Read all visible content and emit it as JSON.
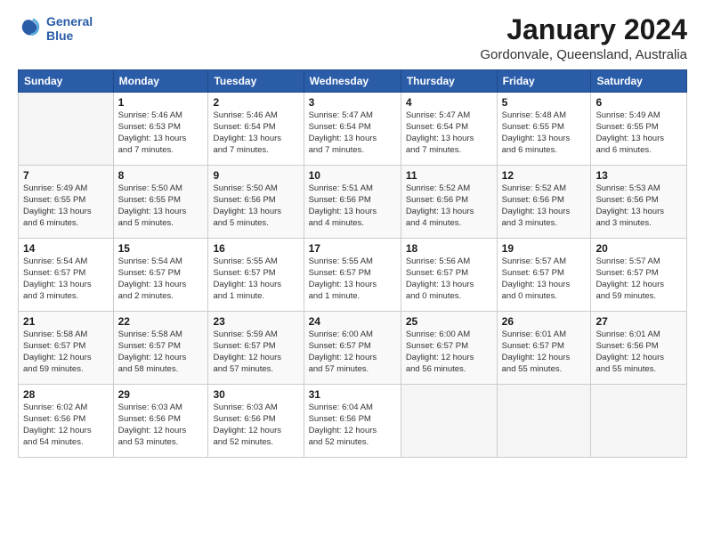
{
  "logo": {
    "line1": "General",
    "line2": "Blue"
  },
  "title": "January 2024",
  "location": "Gordonvale, Queensland, Australia",
  "days_of_week": [
    "Sunday",
    "Monday",
    "Tuesday",
    "Wednesday",
    "Thursday",
    "Friday",
    "Saturday"
  ],
  "weeks": [
    [
      {
        "day": "",
        "info": ""
      },
      {
        "day": "1",
        "info": "Sunrise: 5:46 AM\nSunset: 6:53 PM\nDaylight: 13 hours\nand 7 minutes."
      },
      {
        "day": "2",
        "info": "Sunrise: 5:46 AM\nSunset: 6:54 PM\nDaylight: 13 hours\nand 7 minutes."
      },
      {
        "day": "3",
        "info": "Sunrise: 5:47 AM\nSunset: 6:54 PM\nDaylight: 13 hours\nand 7 minutes."
      },
      {
        "day": "4",
        "info": "Sunrise: 5:47 AM\nSunset: 6:54 PM\nDaylight: 13 hours\nand 7 minutes."
      },
      {
        "day": "5",
        "info": "Sunrise: 5:48 AM\nSunset: 6:55 PM\nDaylight: 13 hours\nand 6 minutes."
      },
      {
        "day": "6",
        "info": "Sunrise: 5:49 AM\nSunset: 6:55 PM\nDaylight: 13 hours\nand 6 minutes."
      }
    ],
    [
      {
        "day": "7",
        "info": "Sunrise: 5:49 AM\nSunset: 6:55 PM\nDaylight: 13 hours\nand 6 minutes."
      },
      {
        "day": "8",
        "info": "Sunrise: 5:50 AM\nSunset: 6:55 PM\nDaylight: 13 hours\nand 5 minutes."
      },
      {
        "day": "9",
        "info": "Sunrise: 5:50 AM\nSunset: 6:56 PM\nDaylight: 13 hours\nand 5 minutes."
      },
      {
        "day": "10",
        "info": "Sunrise: 5:51 AM\nSunset: 6:56 PM\nDaylight: 13 hours\nand 4 minutes."
      },
      {
        "day": "11",
        "info": "Sunrise: 5:52 AM\nSunset: 6:56 PM\nDaylight: 13 hours\nand 4 minutes."
      },
      {
        "day": "12",
        "info": "Sunrise: 5:52 AM\nSunset: 6:56 PM\nDaylight: 13 hours\nand 3 minutes."
      },
      {
        "day": "13",
        "info": "Sunrise: 5:53 AM\nSunset: 6:56 PM\nDaylight: 13 hours\nand 3 minutes."
      }
    ],
    [
      {
        "day": "14",
        "info": "Sunrise: 5:54 AM\nSunset: 6:57 PM\nDaylight: 13 hours\nand 3 minutes."
      },
      {
        "day": "15",
        "info": "Sunrise: 5:54 AM\nSunset: 6:57 PM\nDaylight: 13 hours\nand 2 minutes."
      },
      {
        "day": "16",
        "info": "Sunrise: 5:55 AM\nSunset: 6:57 PM\nDaylight: 13 hours\nand 1 minute."
      },
      {
        "day": "17",
        "info": "Sunrise: 5:55 AM\nSunset: 6:57 PM\nDaylight: 13 hours\nand 1 minute."
      },
      {
        "day": "18",
        "info": "Sunrise: 5:56 AM\nSunset: 6:57 PM\nDaylight: 13 hours\nand 0 minutes."
      },
      {
        "day": "19",
        "info": "Sunrise: 5:57 AM\nSunset: 6:57 PM\nDaylight: 13 hours\nand 0 minutes."
      },
      {
        "day": "20",
        "info": "Sunrise: 5:57 AM\nSunset: 6:57 PM\nDaylight: 12 hours\nand 59 minutes."
      }
    ],
    [
      {
        "day": "21",
        "info": "Sunrise: 5:58 AM\nSunset: 6:57 PM\nDaylight: 12 hours\nand 59 minutes."
      },
      {
        "day": "22",
        "info": "Sunrise: 5:58 AM\nSunset: 6:57 PM\nDaylight: 12 hours\nand 58 minutes."
      },
      {
        "day": "23",
        "info": "Sunrise: 5:59 AM\nSunset: 6:57 PM\nDaylight: 12 hours\nand 57 minutes."
      },
      {
        "day": "24",
        "info": "Sunrise: 6:00 AM\nSunset: 6:57 PM\nDaylight: 12 hours\nand 57 minutes."
      },
      {
        "day": "25",
        "info": "Sunrise: 6:00 AM\nSunset: 6:57 PM\nDaylight: 12 hours\nand 56 minutes."
      },
      {
        "day": "26",
        "info": "Sunrise: 6:01 AM\nSunset: 6:57 PM\nDaylight: 12 hours\nand 55 minutes."
      },
      {
        "day": "27",
        "info": "Sunrise: 6:01 AM\nSunset: 6:56 PM\nDaylight: 12 hours\nand 55 minutes."
      }
    ],
    [
      {
        "day": "28",
        "info": "Sunrise: 6:02 AM\nSunset: 6:56 PM\nDaylight: 12 hours\nand 54 minutes."
      },
      {
        "day": "29",
        "info": "Sunrise: 6:03 AM\nSunset: 6:56 PM\nDaylight: 12 hours\nand 53 minutes."
      },
      {
        "day": "30",
        "info": "Sunrise: 6:03 AM\nSunset: 6:56 PM\nDaylight: 12 hours\nand 52 minutes."
      },
      {
        "day": "31",
        "info": "Sunrise: 6:04 AM\nSunset: 6:56 PM\nDaylight: 12 hours\nand 52 minutes."
      },
      {
        "day": "",
        "info": ""
      },
      {
        "day": "",
        "info": ""
      },
      {
        "day": "",
        "info": ""
      }
    ]
  ]
}
